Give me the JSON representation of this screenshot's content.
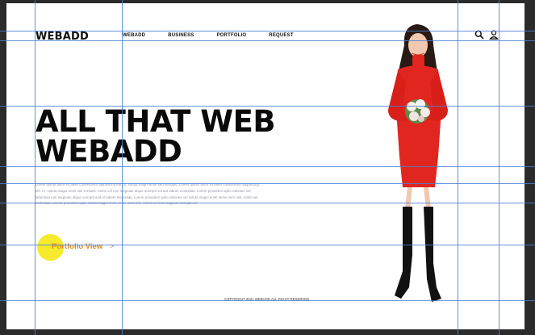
{
  "header": {
    "logo": "WEBADD",
    "nav": [
      "WEBADD",
      "BUSINESS",
      "PORTFOLIO",
      "REQUEST"
    ],
    "icons": [
      "search-icon",
      "user-icon"
    ]
  },
  "hero": {
    "headline_line1": "ALL THAT WEB",
    "headline_line2": "WEBADD",
    "blurb_lines": [
      "Lorem ipsum dolor sit amet consectetur adipisicing elit. In, soluta magni enim sed veritatis. Lorem ipsum dolor sit amet consectetur adipisicing",
      "elit. In, soluta magni enim nisi veritatis. Animi vel non magnam atque suscipit vel aut labore molestias. Lorem provident optio rationes vel",
      "laboriosa non magnam atque corrupti sed ut labore molestias. Lorem provident optio rationes vel soluta magni enim nemo vero nisi. Animi vel",
      "molestias. Lorem provident optio soluta magni enim nemo vero nisi. Animi vel non magnam suscipit vel"
    ],
    "cta_label": "Portfolio View",
    "cta_arrow": ">"
  },
  "footer": {
    "copyright": "COPYRIGHT 2021 WEBADD ALL RIGHT RESERVED"
  },
  "colors": {
    "accent_dot": "#f6ea2c",
    "cta_text": "#e08a1e",
    "dress": "#e0261f",
    "guide": "#4a7fd6"
  }
}
